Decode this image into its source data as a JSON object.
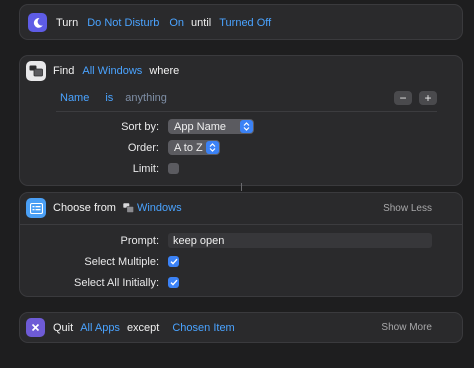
{
  "turn_action": {
    "keyword_turn": "Turn",
    "focus": "Do Not Disturb",
    "state": "On",
    "keyword_until": "until",
    "until": "Turned Off",
    "icon": "moon-icon"
  },
  "find_action": {
    "keyword_find": "Find",
    "scope": "All Windows",
    "keyword_where": "where",
    "icon": "windows-icon",
    "filter": {
      "field": "Name",
      "operator": "is",
      "value": "anything",
      "remove": "−",
      "add": "+"
    },
    "sort_label": "Sort by:",
    "sort_value": "App Name",
    "order_label": "Order:",
    "order_value": "A to Z",
    "limit_label": "Limit:",
    "limit_checked": false
  },
  "choose_action": {
    "keyword": "Choose from",
    "source": "Windows",
    "toggle": "Show Less",
    "icon": "list-icon",
    "prompt_label": "Prompt:",
    "prompt_value": "keep open",
    "select_multiple_label": "Select Multiple:",
    "select_multiple_checked": true,
    "select_all_label": "Select All Initially:",
    "select_all_checked": true
  },
  "quit_action": {
    "keyword_quit": "Quit",
    "target": "All Apps",
    "keyword_except": "except",
    "except_value": "Chosen Item",
    "toggle": "Show More",
    "icon": "close-icon"
  },
  "colors": {
    "background": "#1e1e1f",
    "card": "#2a2a2c",
    "accent": "#4aa3ff",
    "checkbox_on": "#3b82f6",
    "turn_icon_bg": "#5e5ce6",
    "quit_icon_bg": "#6e5bd6",
    "choose_icon_bg": "#4a9ff5"
  }
}
